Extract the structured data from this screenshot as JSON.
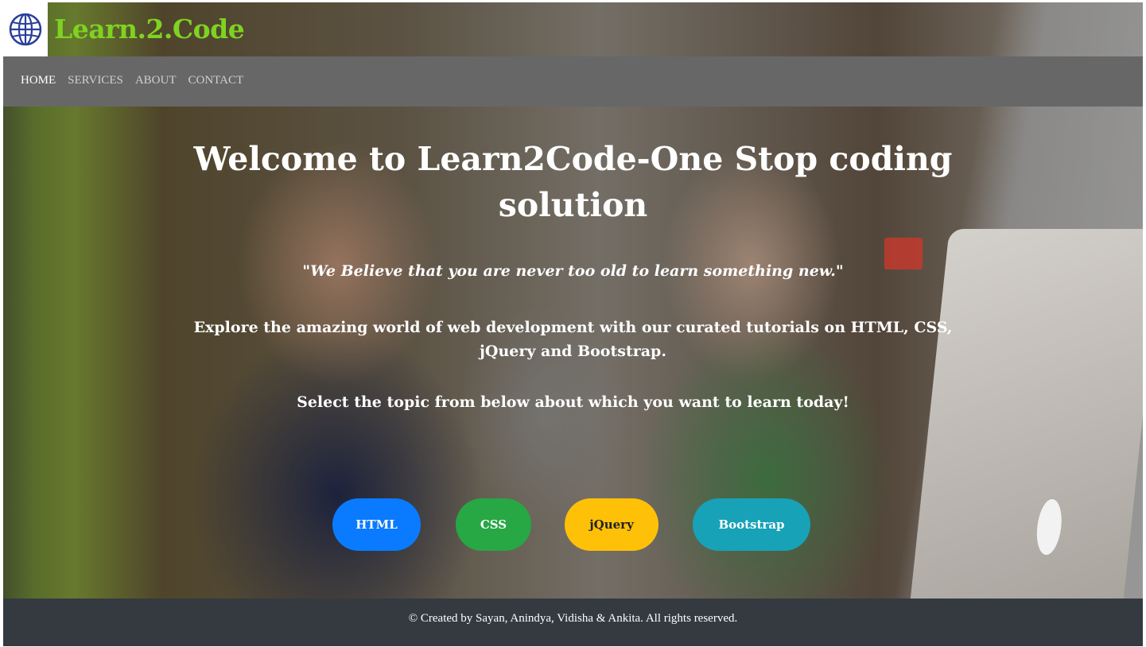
{
  "brand": {
    "name": "Learn.2.Code",
    "logo_icon": "globe-icon",
    "color": "#7ed321"
  },
  "nav": {
    "items": [
      {
        "label": "HOME",
        "active": true
      },
      {
        "label": "SERVICES",
        "active": false
      },
      {
        "label": "ABOUT",
        "active": false
      },
      {
        "label": "CONTACT",
        "active": false
      }
    ]
  },
  "hero": {
    "title": "Welcome to Learn2Code-One Stop coding solution",
    "quote": "\"We Believe that you are never too old to learn something new.\"",
    "explore": "Explore the amazing world of web development with our curated tutorials on HTML, CSS, jQuery and Bootstrap.",
    "select_prompt": "Select the topic from below about which you want to learn today!"
  },
  "buttons": [
    {
      "label": "HTML",
      "color": "#0a7bff"
    },
    {
      "label": "CSS",
      "color": "#28a745"
    },
    {
      "label": "jQuery",
      "color": "#ffc107"
    },
    {
      "label": "Bootstrap",
      "color": "#17a2b8"
    }
  ],
  "footer": {
    "text": "© Created by Sayan, Anindya, Vidisha & Ankita. All rights reserved."
  }
}
